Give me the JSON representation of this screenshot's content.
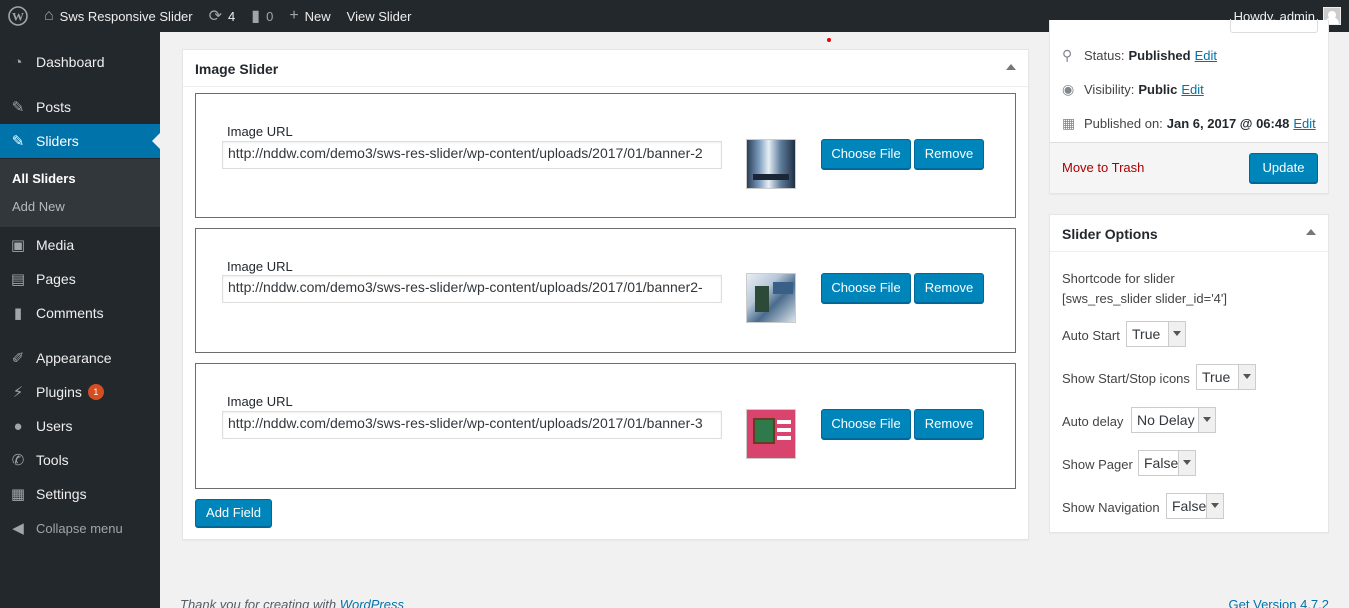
{
  "adminbar": {
    "site_name": "Sws Responsive Slider",
    "updates_count": "4",
    "comments_count": "0",
    "new_label": "New",
    "view_label": "View Slider",
    "howdy": "Howdy, admin"
  },
  "sidebar": {
    "dashboard": "Dashboard",
    "posts": "Posts",
    "sliders": "Sliders",
    "all_sliders": "All Sliders",
    "add_new": "Add New",
    "media": "Media",
    "pages": "Pages",
    "comments": "Comments",
    "appearance": "Appearance",
    "plugins": "Plugins",
    "plugins_badge": "1",
    "users": "Users",
    "tools": "Tools",
    "settings": "Settings",
    "collapse": "Collapse menu"
  },
  "image_slider": {
    "title": "Image Slider",
    "fields": [
      {
        "label": "Image URL",
        "url": "http://nddw.com/demo3/sws-res-slider/wp-content/uploads/2017/01/banner-2",
        "choose": "Choose File",
        "remove": "Remove"
      },
      {
        "label": "Image URL",
        "url": "http://nddw.com/demo3/sws-res-slider/wp-content/uploads/2017/01/banner2-",
        "choose": "Choose File",
        "remove": "Remove"
      },
      {
        "label": "Image URL",
        "url": "http://nddw.com/demo3/sws-res-slider/wp-content/uploads/2017/01/banner-3",
        "choose": "Choose File",
        "remove": "Remove"
      }
    ],
    "add_field": "Add Field"
  },
  "publish": {
    "status_label": "Status:",
    "status_value": "Published",
    "visibility_label": "Visibility:",
    "visibility_value": "Public",
    "published_label": "Published on:",
    "published_value": "Jan 6, 2017 @ 06:48",
    "edit": "Edit",
    "trash": "Move to Trash",
    "update": "Update"
  },
  "slider_options": {
    "title": "Slider Options",
    "shortcode_label": "Shortcode for slider",
    "shortcode_value": "[sws_res_slider slider_id='4']",
    "auto_start_label": "Auto Start",
    "auto_start_value": "True",
    "icons_label": "Show Start/Stop icons",
    "icons_value": "True",
    "delay_label": "Auto delay",
    "delay_value": "No Delay",
    "pager_label": "Show Pager",
    "pager_value": "False",
    "nav_label": "Show Navigation",
    "nav_value": "False"
  },
  "footer": {
    "thanks": "Thank you for creating with",
    "wordpress": "WordPress",
    "version": "Get Version 4.7.2"
  }
}
